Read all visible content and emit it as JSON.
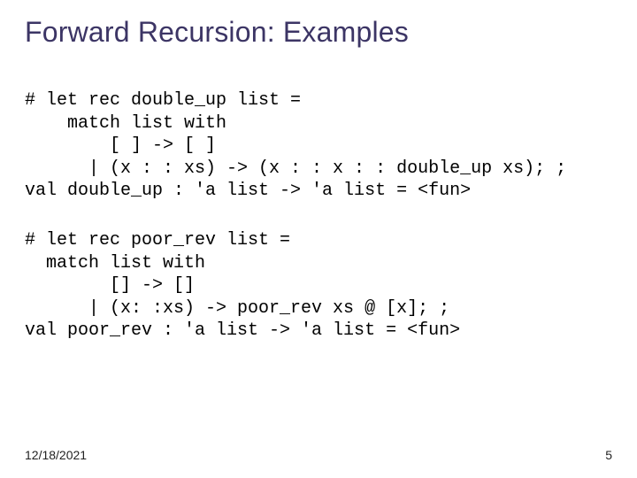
{
  "title": "Forward Recursion: Examples",
  "code1": "# let rec double_up list =\n    match list with\n        [ ] -> [ ]\n      | (x : : xs) -> (x : : x : : double_up xs); ;\nval double_up : 'a list -> 'a list = <fun>",
  "code2": "# let rec poor_rev list =\n  match list with\n        [] -> []\n      | (x: :xs) -> poor_rev xs @ [x]; ;\nval poor_rev : 'a list -> 'a list = <fun>",
  "footer": {
    "date": "12/18/2021",
    "page": "5"
  }
}
